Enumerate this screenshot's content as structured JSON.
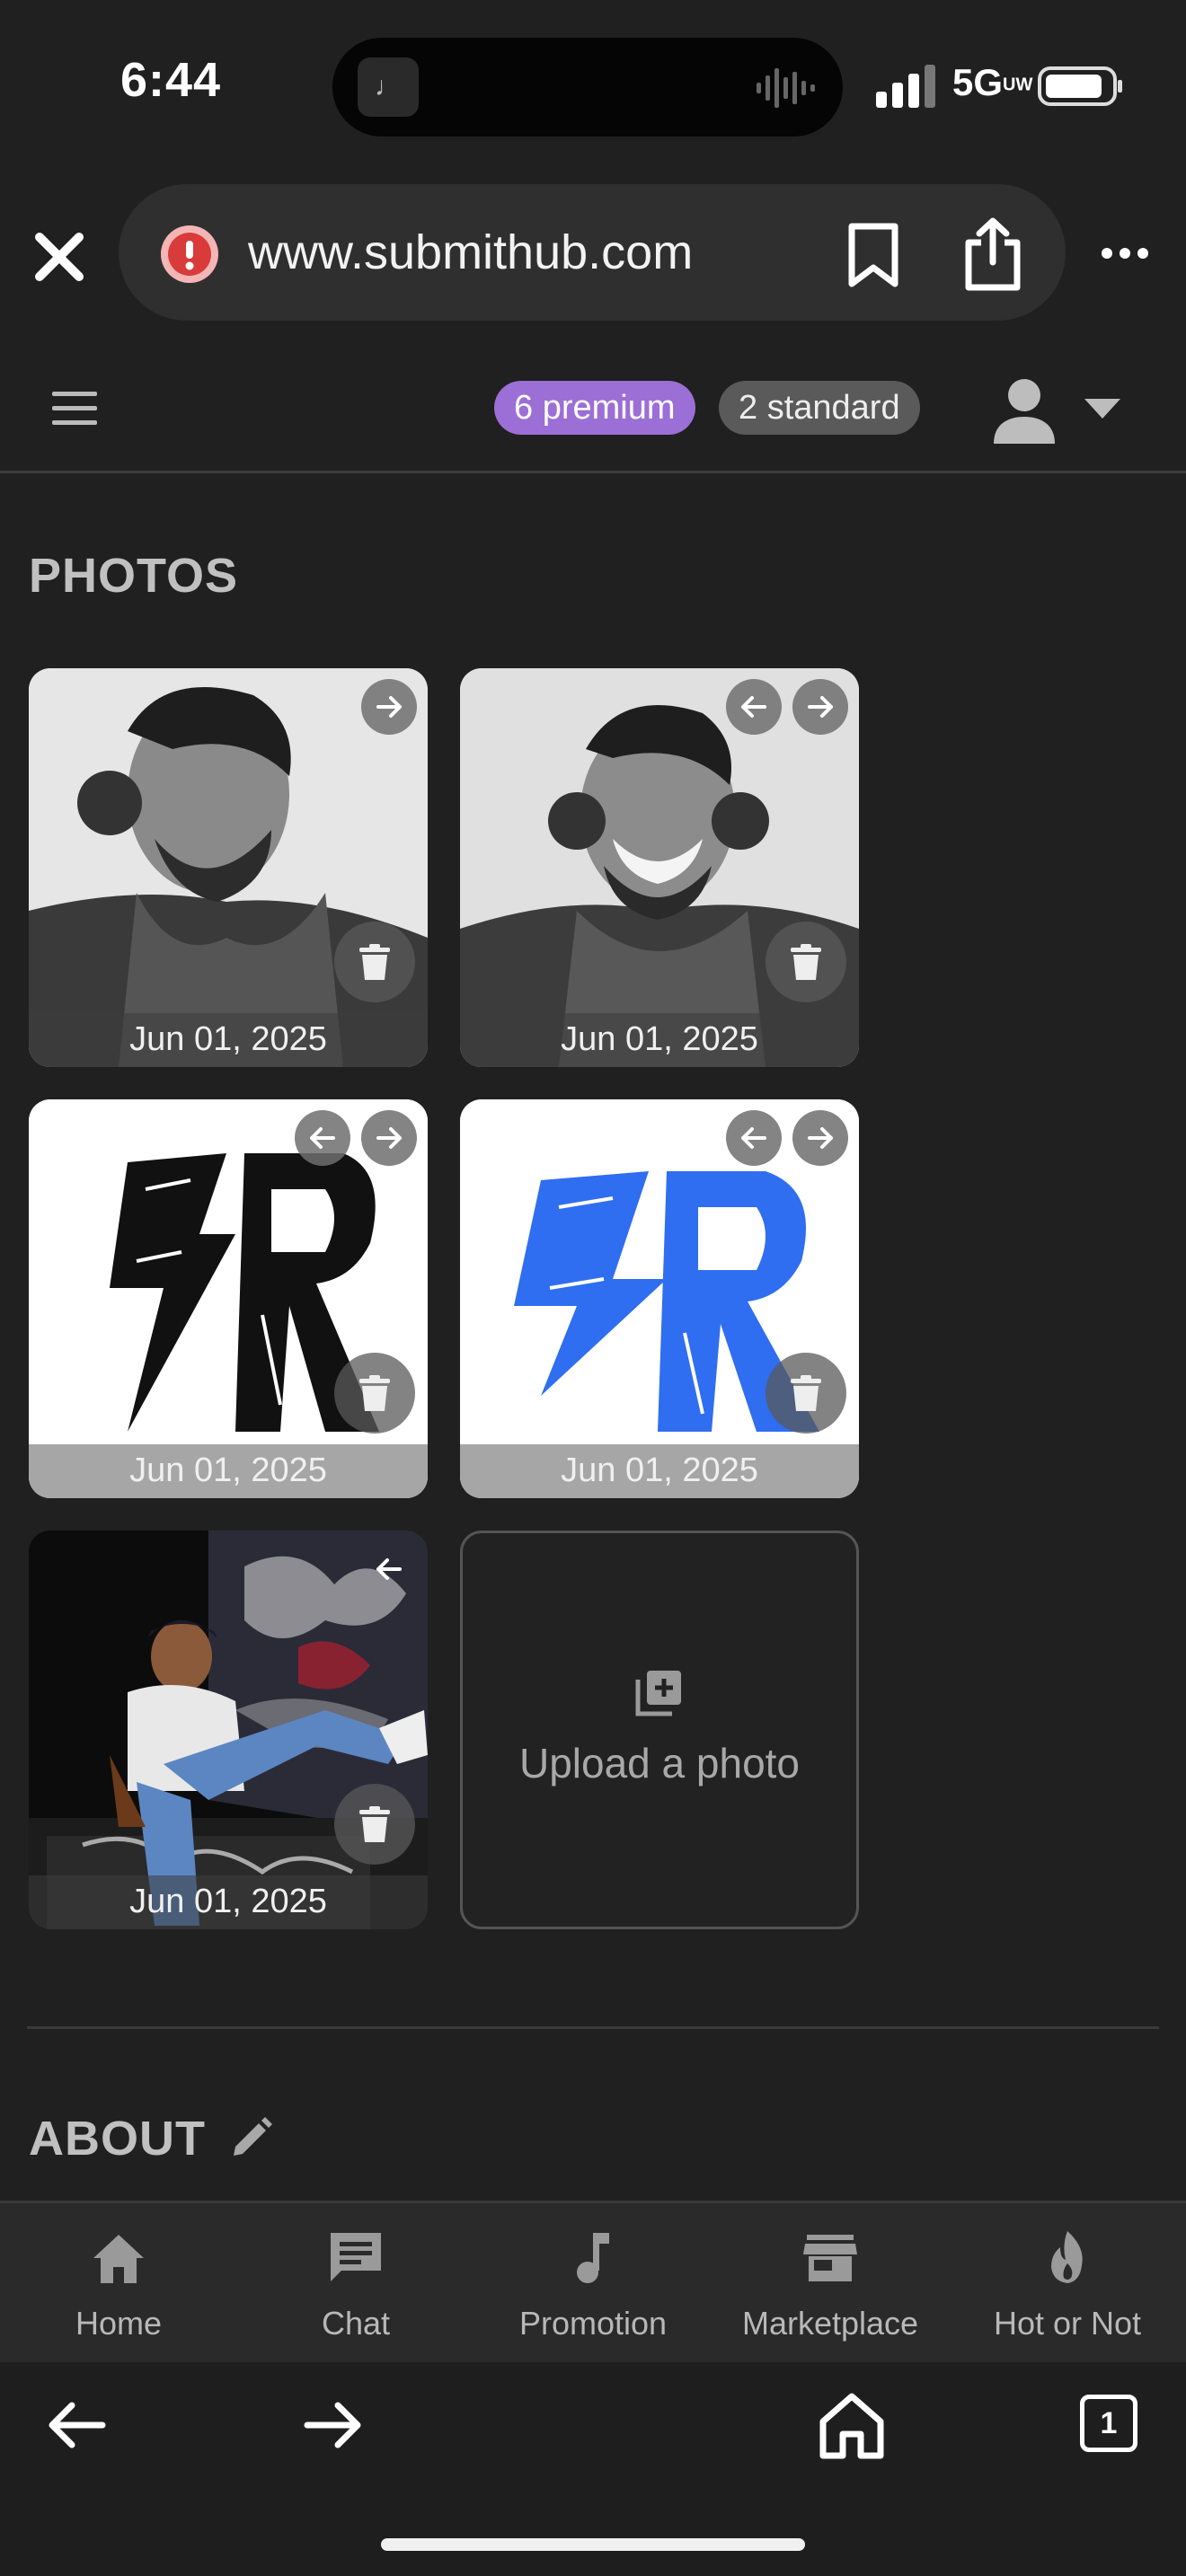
{
  "status_bar": {
    "time": "6:44",
    "network": "5G",
    "network_suffix": "UW",
    "island_app_glyph": "♩"
  },
  "browser": {
    "url": "www.submithub.com",
    "icons": [
      "close-icon",
      "alert-icon",
      "bookmark-icon",
      "share-icon",
      "more-icon"
    ]
  },
  "header": {
    "premium_badge": "6 premium",
    "standard_badge": "2 standard",
    "premium_color": "#9b6fd6",
    "standard_color": "#5a5a5a"
  },
  "photos": {
    "title": "PHOTOS",
    "items": [
      {
        "date": "Jun 01, 2025",
        "subject": "black-and-white selfie with headphones",
        "arrows": [
          "right"
        ]
      },
      {
        "date": "Jun 01, 2025",
        "subject": "black-and-white smiling selfie with headphones",
        "arrows": [
          "left",
          "right"
        ]
      },
      {
        "date": "Jun 01, 2025",
        "subject": "black SR scribble logo",
        "arrows": [
          "left",
          "right"
        ]
      },
      {
        "date": "Jun 01, 2025",
        "subject": "blue SR scribble logo",
        "arrows": [
          "left",
          "right"
        ]
      },
      {
        "date": "Jun 01, 2025",
        "subject": "seated person in front of graffiti wall",
        "arrows": [
          "left"
        ]
      }
    ],
    "upload_label": "Upload a photo"
  },
  "about": {
    "title": "ABOUT"
  },
  "bottom_nav": [
    {
      "label": "Home",
      "icon": "home-icon"
    },
    {
      "label": "Chat",
      "icon": "chat-icon"
    },
    {
      "label": "Promotion",
      "icon": "music-note-icon"
    },
    {
      "label": "Marketplace",
      "icon": "store-icon"
    },
    {
      "label": "Hot or Not",
      "icon": "flame-icon"
    }
  ],
  "toolbar": {
    "tab_count": "1"
  }
}
